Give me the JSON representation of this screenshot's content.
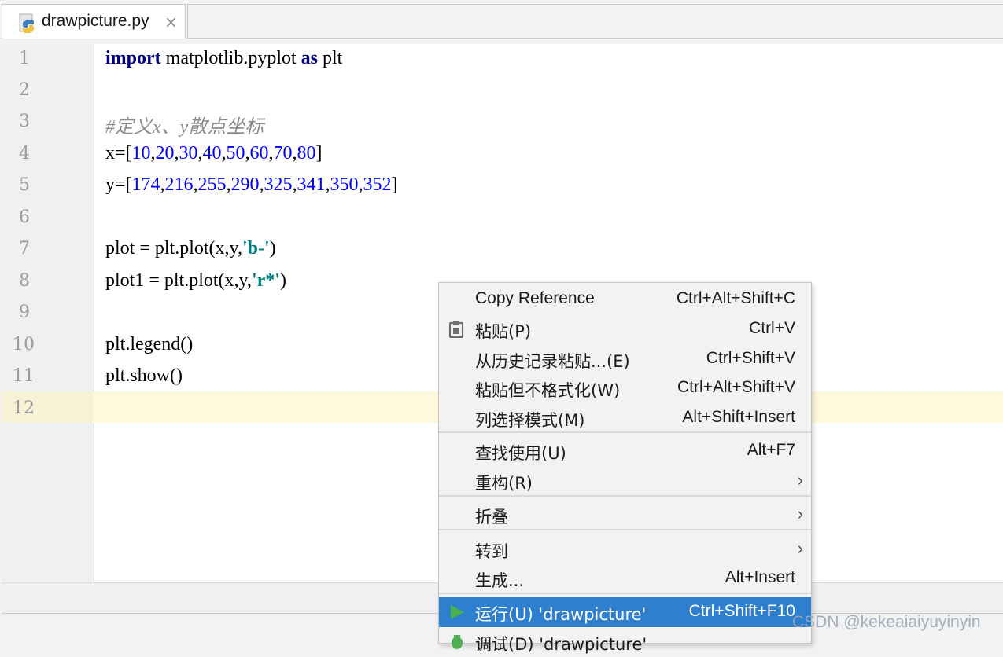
{
  "tab": {
    "title": "drawpicture.py",
    "close_symbol": "×",
    "icon": "python-file-icon"
  },
  "editor": {
    "line_numbers": [
      "1",
      "2",
      "3",
      "4",
      "5",
      "6",
      "7",
      "8",
      "9",
      "10",
      "11",
      "12"
    ],
    "current_line": "12",
    "code": {
      "l1_kw1": "import",
      "l1_mod": " matplotlib.pyplot ",
      "l1_kw2": "as",
      "l1_alias": " plt",
      "l3_comment": "#定义x、y散点坐标",
      "l4_prefix": "x=[",
      "l4_vals": [
        "10",
        "20",
        "30",
        "40",
        "50",
        "60",
        "70",
        "80"
      ],
      "l4_suffix": "]",
      "l5_prefix": "y=[",
      "l5_vals": [
        "174",
        "216",
        "255",
        "290",
        "325",
        "341",
        "350",
        "352"
      ],
      "l5_suffix": "]",
      "l7_pre": "plot = plt.plot(x,y,",
      "l7_str": "'b-'",
      "l7_post": ")",
      "l8_pre": "plot1 = plt.plot(x,y,",
      "l8_str": "'r*'",
      "l8_post": ")",
      "l10": "plt.legend()",
      "l11": "plt.show()"
    },
    "colors": {
      "keyword": "#000080",
      "number": "#0000ff",
      "comment": "#8c8c8c",
      "string": "#008080",
      "current_line_bg": "#fef8dc"
    }
  },
  "context_menu": {
    "items": [
      {
        "label": "Copy Reference",
        "shortcut": "Ctrl+Alt+Shift+C"
      },
      {
        "label": "粘贴(P)",
        "shortcut": "Ctrl+V",
        "icon": "clipboard-icon"
      },
      {
        "label": "从历史记录粘贴...(E)",
        "shortcut": "Ctrl+Shift+V"
      },
      {
        "label": "粘贴但不格式化(W)",
        "shortcut": "Ctrl+Alt+Shift+V"
      },
      {
        "label": "列选择模式(M)",
        "shortcut": "Alt+Shift+Insert"
      },
      {
        "label": "查找使用(U)",
        "shortcut": "Alt+F7"
      },
      {
        "label": "重构(R)",
        "submenu": true
      },
      {
        "label": "折叠",
        "submenu": true
      },
      {
        "label": "转到",
        "submenu": true
      },
      {
        "label": "生成...",
        "shortcut": "Alt+Insert"
      },
      {
        "label": "运行(U) 'drawpicture'",
        "shortcut": "Ctrl+Shift+F10",
        "icon": "run-icon",
        "selected": true
      },
      {
        "label": "调试(D) 'drawpicture'",
        "icon": "debug-icon"
      }
    ],
    "submenu_arrow": "›",
    "selected_color": "#2f7fcf"
  },
  "watermark": "CSDN @kekeaiaiyuyinyin"
}
